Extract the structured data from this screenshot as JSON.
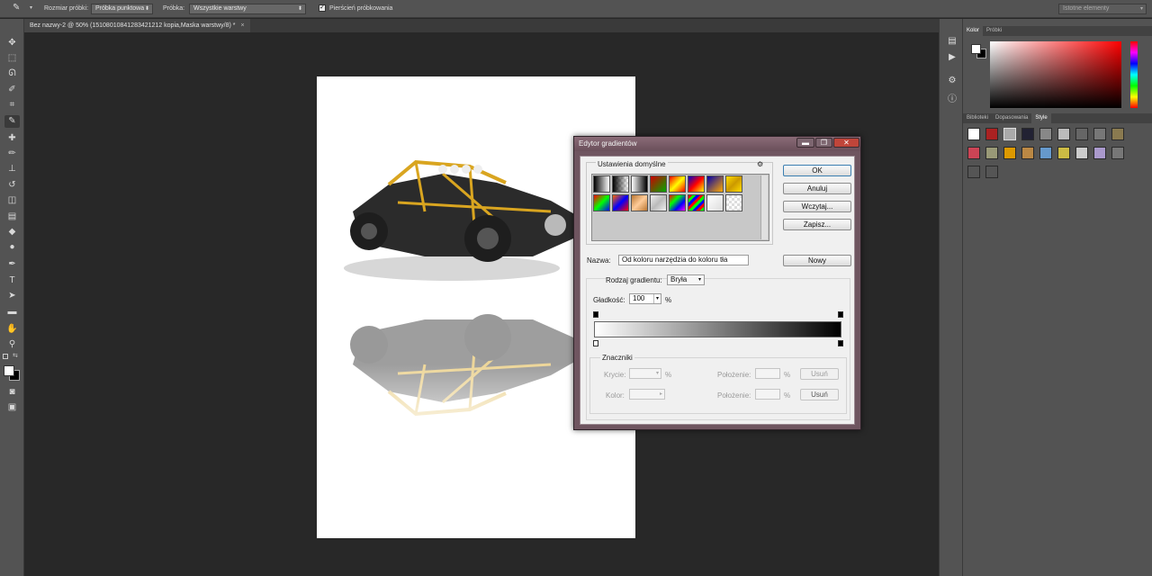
{
  "options_bar": {
    "sample_size_label": "Rozmiar próbki:",
    "sample_size_value": "Próbka punktowa",
    "sample_label": "Próbka:",
    "sample_value": "Wszystkie warstwy",
    "sampling_ring_label": "Pierścień próbkowania",
    "sampling_ring_checked": true,
    "workspace_value": "Istotne elementy"
  },
  "document_tab": {
    "title": "Bez nazwy-2 @ 50% (15108010841283421212 kopia,Maska warstwy/8) *",
    "close": "×"
  },
  "right_panel": {
    "top_tabs": [
      "Kolor",
      "Próbki"
    ],
    "bottom_tabs": [
      "Biblioteki",
      "Dopasowania",
      "Style"
    ],
    "active_bottom_tab": "Style"
  },
  "dialog": {
    "title": "Edytor gradientów",
    "window_buttons": {
      "minimize": "▬",
      "maximize": "❐",
      "close": "✕"
    },
    "presets_label": "Ustawienia domyślne",
    "presets_gear": "⚙",
    "buttons": {
      "ok": "OK",
      "cancel": "Anuluj",
      "load": "Wczytaj...",
      "save": "Zapisz...",
      "new": "Nowy"
    },
    "name_label": "Nazwa:",
    "name_value": "Od koloru narzędzia do koloru tła",
    "gradient_type_label": "Rodzaj gradientu:",
    "gradient_type_value": "Bryła",
    "smoothness_label": "Gładkość:",
    "smoothness_value": "100",
    "percent": "%",
    "stops_label": "Znaczniki",
    "opacity_label": "Krycie:",
    "location_label": "Położenie:",
    "delete_label": "Usuń",
    "color_label": "Kolor:",
    "gradient_start_color": "#ffffff",
    "gradient_end_color": "#000000",
    "accent_color": "#6f5560"
  }
}
